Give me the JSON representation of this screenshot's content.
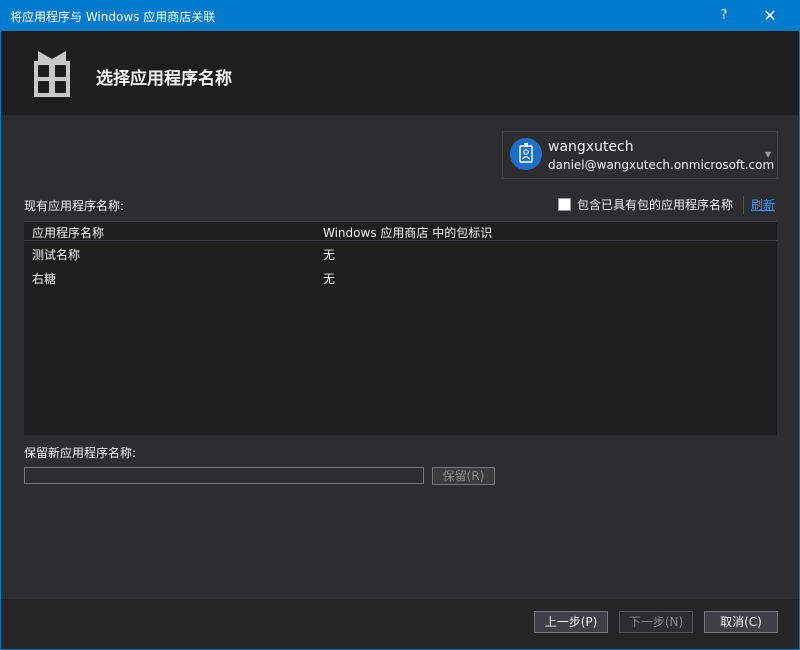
{
  "window": {
    "title": "将应用程序与 Windows 应用商店关联",
    "help": "?",
    "close": "✕"
  },
  "header": {
    "title": "选择应用程序名称"
  },
  "account": {
    "name": "wangxutech",
    "email": "daniel@wangxutech.onmicrosoft.com"
  },
  "existing": {
    "label": "现有应用程序名称:",
    "include_packaged_label": "包含已具有包的应用程序名称",
    "include_packaged_checked": false,
    "refresh": "刷新",
    "columns": [
      "应用程序名称",
      "Windows 应用商店 中的包标识"
    ],
    "rows": [
      [
        "测试名称",
        "无"
      ],
      [
        "右糖",
        "无"
      ]
    ]
  },
  "reserve": {
    "label": "保留新应用程序名称:",
    "value": "",
    "button": "保留(R)"
  },
  "footer": {
    "prev": "上一步(P)",
    "next": "下一步(N)",
    "cancel": "取消(C)"
  }
}
